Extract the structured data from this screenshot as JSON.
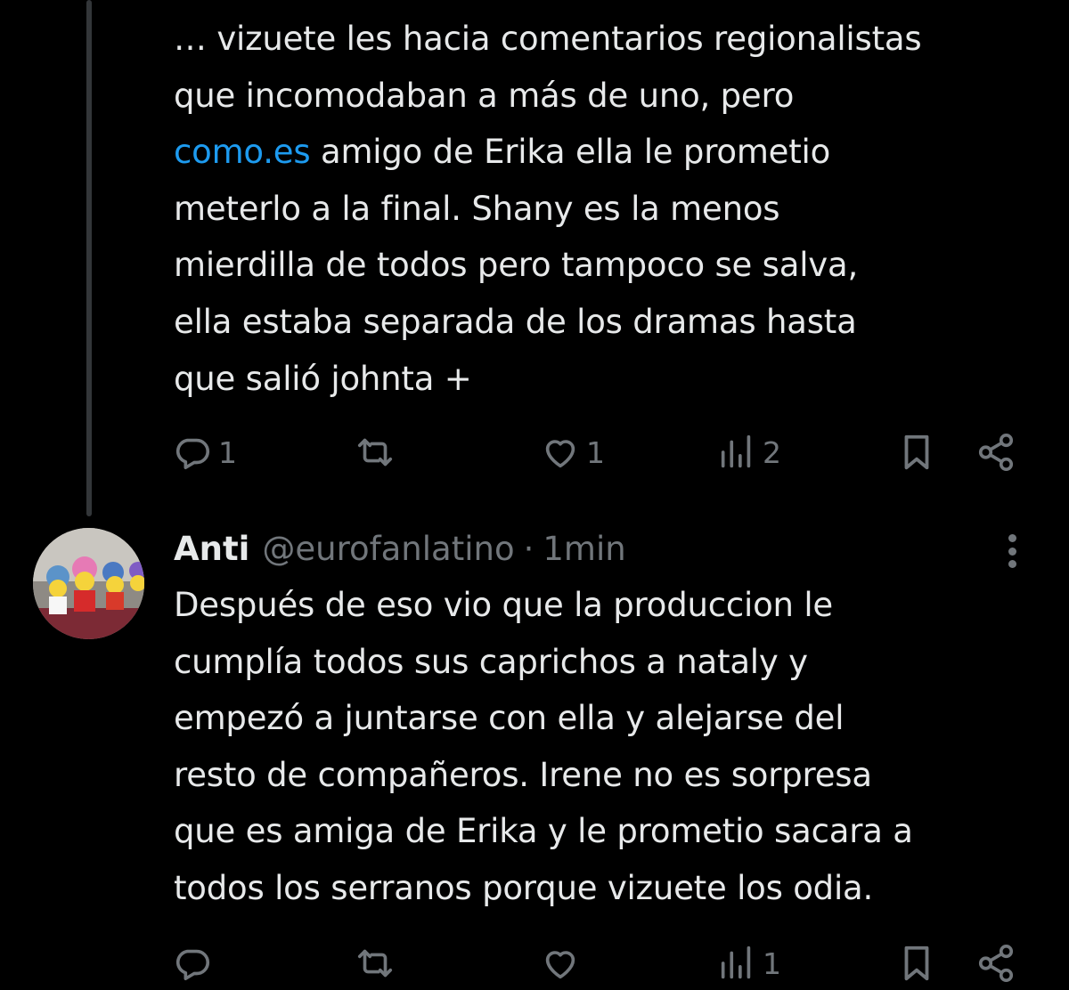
{
  "tweet1": {
    "lines": [
      "… vizuete les hacia comentarios regionalistas",
      "que incomodaban a más de uno, pero",
      "amigo de Erika ella le prometio",
      "meterlo a la final. Shany es la menos",
      "mierdilla de todos pero tampoco se salva,",
      "ella estaba separada de los dramas hasta",
      "que salió johnta +"
    ],
    "link": "como.es",
    "replies": "1",
    "likes": "1",
    "views": "2"
  },
  "tweet2": {
    "name": "Anti",
    "handle": "@eurofanlatino",
    "dot": "·",
    "time": "1min",
    "lines": [
      "Después de eso vio que la produccion le",
      "cumplía todos sus caprichos a nataly y",
      "empezó a juntarse con ella y alejarse del",
      "resto de compañeros. Irene no es sorpresa",
      "que es amiga de Erika y le prometio sacara a",
      "todos los serranos porque vizuete los odia."
    ],
    "views": "1"
  },
  "colors": {
    "background": "#000000",
    "text": "#e7e9ea",
    "muted": "#71767b",
    "link": "#1d9bf0"
  }
}
